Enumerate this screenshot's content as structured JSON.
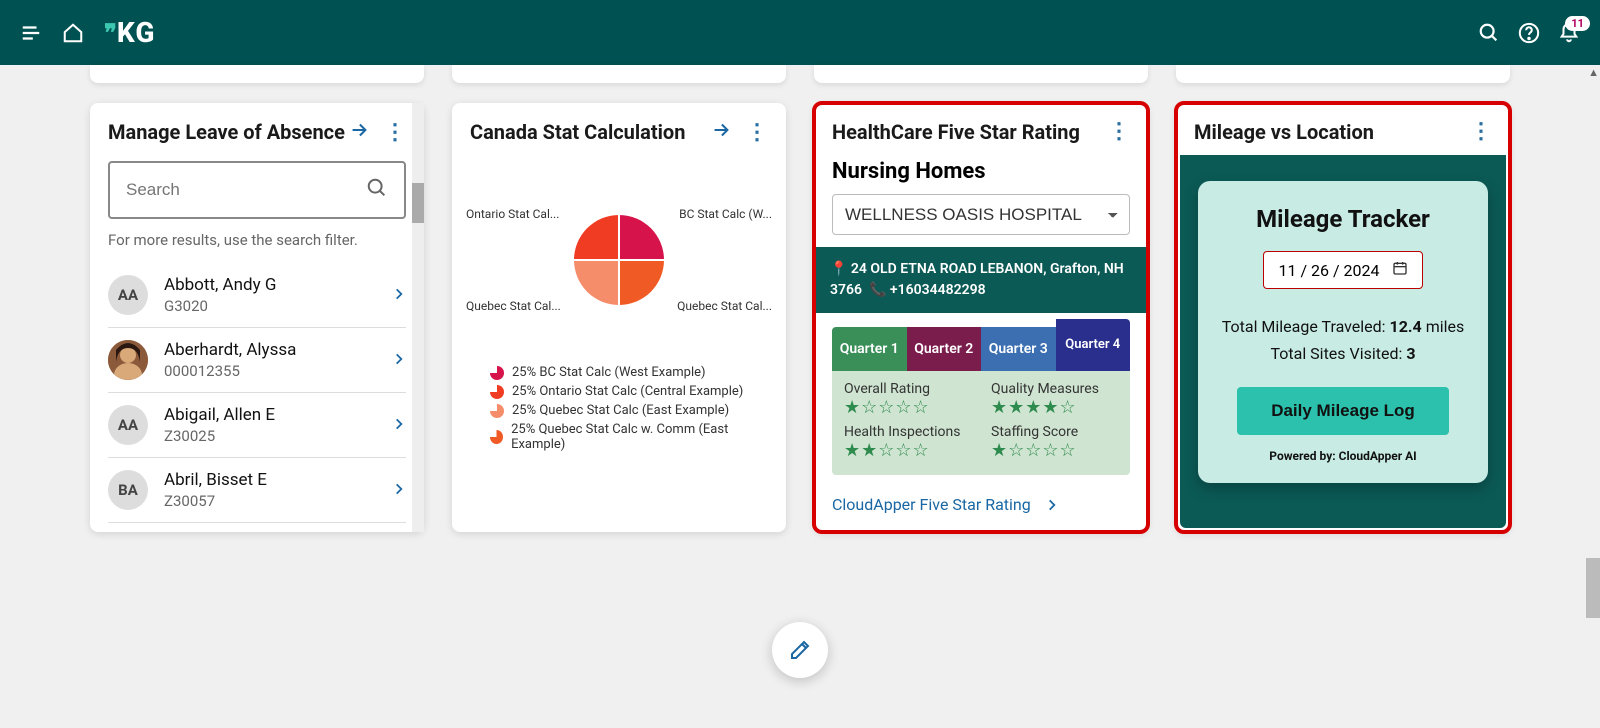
{
  "header": {
    "logo_text": "KG",
    "notification_count": "11"
  },
  "cards": {
    "leave": {
      "title": "Manage Leave of Absence",
      "search_placeholder": "Search",
      "hint": "For more results, use the search filter.",
      "people": [
        {
          "initials": "AA",
          "name": "Abbott, Andy G",
          "sub": "G3020"
        },
        {
          "initials": "",
          "name": "Aberhardt, Alyssa",
          "sub": "000012355",
          "photo": true
        },
        {
          "initials": "AA",
          "name": "Abigail, Allen E",
          "sub": "Z30025"
        },
        {
          "initials": "BA",
          "name": "Abril, Bisset E",
          "sub": "Z30057"
        }
      ]
    },
    "canada": {
      "title": "Canada Stat Calculation",
      "labels": {
        "tl": "Ontario Stat Cal...",
        "tr": "BC Stat Calc (W...",
        "bl": "Quebec Stat Cal...",
        "br": "Quebec Stat Cal..."
      },
      "legend": [
        {
          "color": "#d6134b",
          "text": "25% BC Stat Calc (West Example)"
        },
        {
          "color": "#ef3c23",
          "text": "25% Ontario Stat Calc (Central Example)"
        },
        {
          "color": "#f58d6b",
          "text": "25% Quebec Stat Calc (East Example)"
        },
        {
          "color": "#f05a24",
          "text": "25% Quebec Stat Calc w. Comm (East Example)"
        }
      ]
    },
    "healthcare": {
      "title": "HealthCare Five Star Rating",
      "subtitle": "Nursing Homes",
      "selected": "WELLNESS OASIS HOSPITAL",
      "address": "24 OLD ETNA ROAD LEBANON, Grafton, NH 3766",
      "phone": "+16034482298",
      "quarters": [
        "Quarter 1",
        "Quarter 2",
        "Quarter 3",
        "Quarter 4"
      ],
      "metrics": {
        "overall": {
          "label": "Overall Rating",
          "stars": 1
        },
        "quality": {
          "label": "Quality Measures",
          "stars": 4
        },
        "health": {
          "label": "Health Inspections",
          "stars": 2
        },
        "staffing": {
          "label": "Staffing Score",
          "stars": 1
        }
      },
      "link": "CloudApper Five Star Rating"
    },
    "mileage": {
      "title": "Mileage vs Location",
      "tracker_title": "Mileage Tracker",
      "date": "11 / 26 / 2024",
      "total_label": "Total Mileage Traveled: ",
      "total_value": "12.4",
      "total_unit": " miles",
      "sites_label": "Total Sites Visited: ",
      "sites_value": "3",
      "button": "Daily Mileage Log",
      "powered": "Powered by: CloudApper AI"
    }
  },
  "chart_data": {
    "type": "pie",
    "title": "Canada Stat Calculation",
    "series": [
      {
        "name": "BC Stat Calc (West Example)",
        "value": 25,
        "color": "#d6134b"
      },
      {
        "name": "Ontario Stat Calc (Central Example)",
        "value": 25,
        "color": "#ef3c23"
      },
      {
        "name": "Quebec Stat Calc (East Example)",
        "value": 25,
        "color": "#f58d6b"
      },
      {
        "name": "Quebec Stat Calc w. Comm (East Example)",
        "value": 25,
        "color": "#f05a24"
      }
    ]
  }
}
